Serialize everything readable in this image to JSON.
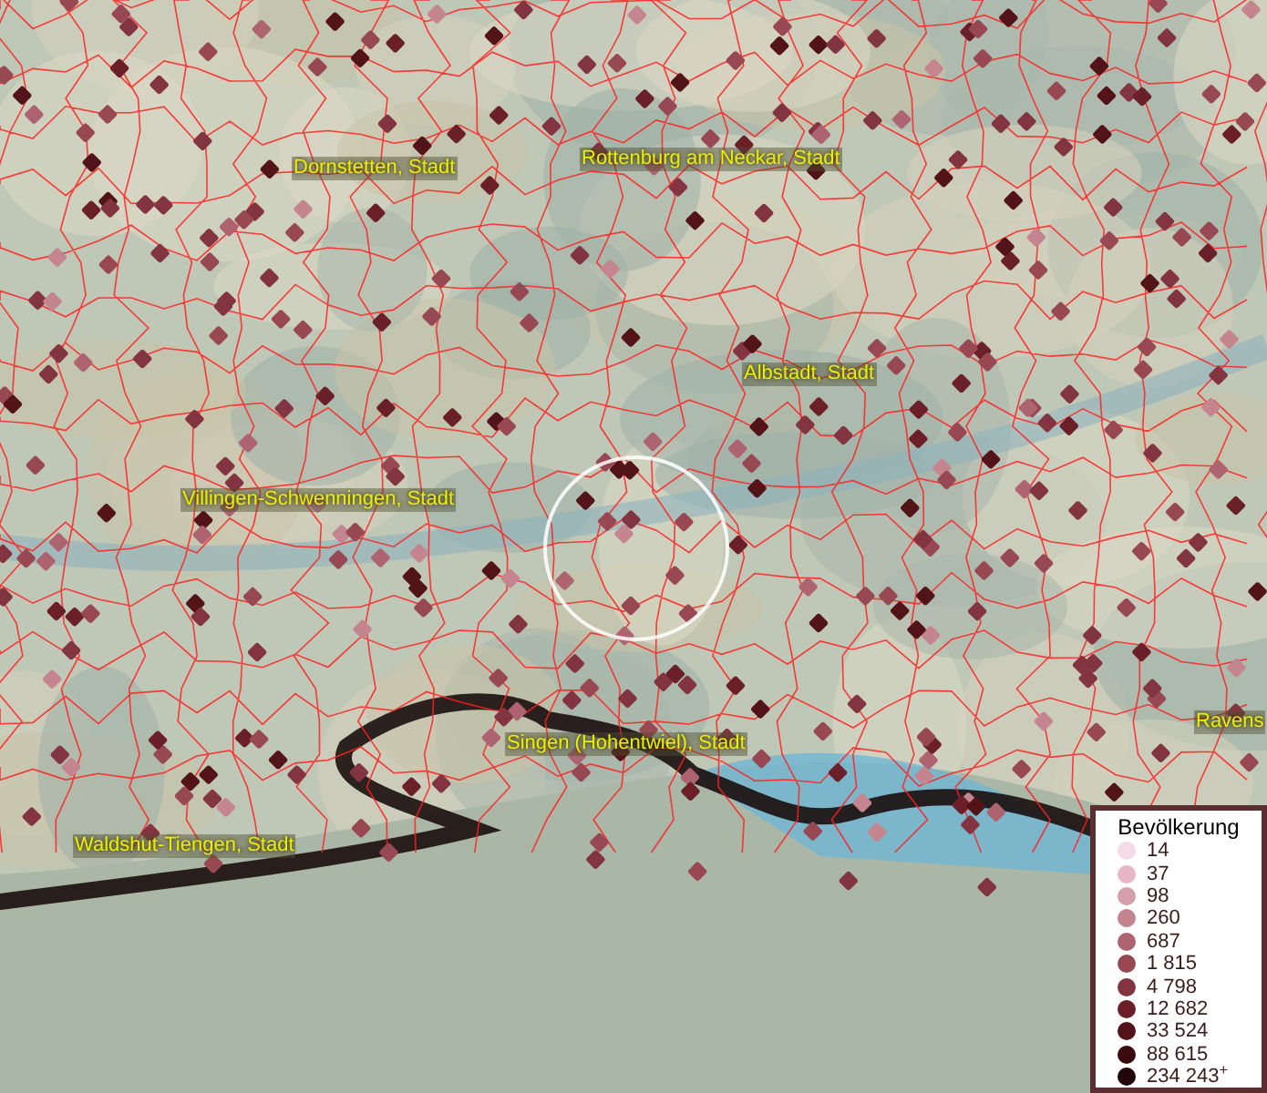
{
  "map_labels": [
    {
      "text": "Dornstetten, Stadt"
    },
    {
      "text": "Rottenburg am Neckar, Stadt"
    },
    {
      "text": "Albstadt, Stadt"
    },
    {
      "text": "Villingen-Schwenningen, Stadt"
    },
    {
      "text": "Singen (Hohentwiel), Stadt"
    },
    {
      "text": "Waldshut-Tiengen, Stadt"
    },
    {
      "text": "Ravens"
    }
  ],
  "legend": {
    "title": "Bevölkerung",
    "items": [
      {
        "label": "14",
        "color": "#f5dbe6"
      },
      {
        "label": "37",
        "color": "#e6b6c6"
      },
      {
        "label": "98",
        "color": "#d49fab"
      },
      {
        "label": "260",
        "color": "#c4858f"
      },
      {
        "label": "687",
        "color": "#ae6470"
      },
      {
        "label": "1 815",
        "color": "#984852"
      },
      {
        "label": "4 798",
        "color": "#833441"
      },
      {
        "label": "12 682",
        "color": "#6a1f29"
      },
      {
        "label": "33 524",
        "color": "#521319"
      },
      {
        "label": "88 615",
        "color": "#3c0a0e"
      },
      {
        "label": "234 243$^{+}$",
        "color": "#21060a"
      }
    ]
  }
}
